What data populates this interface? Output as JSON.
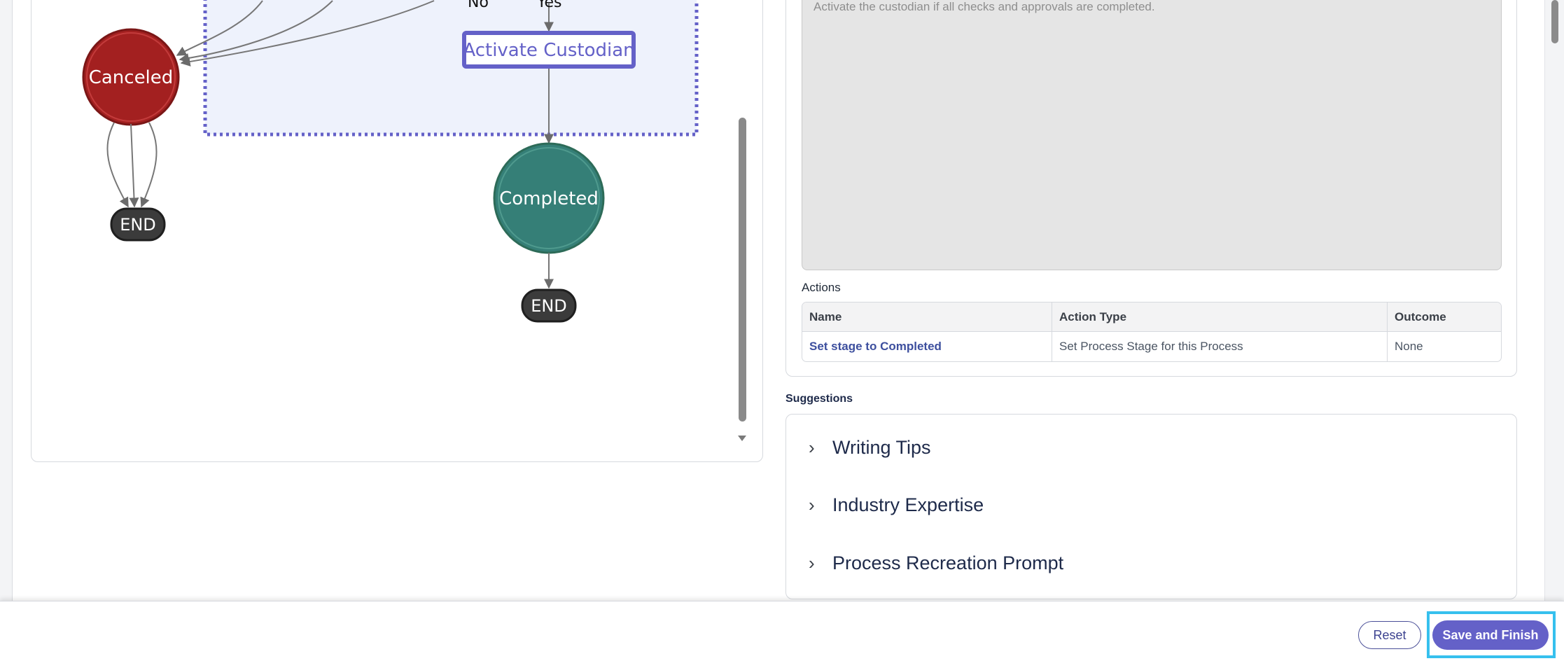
{
  "diagram": {
    "labels": {
      "no": "No",
      "yes": "Yes",
      "canceled": "Canceled",
      "activate": "Activate Custodian",
      "completed": "Completed",
      "end": "END"
    },
    "colors": {
      "canceled": "#a32020",
      "completed": "#357f77",
      "activate": "#6461c8",
      "end": "#3b3b3b",
      "group_fill": "#eef2fc",
      "group_border": "#6461c8"
    }
  },
  "details": {
    "description": "Activate the custodian if all checks and approvals are completed.",
    "actions_label": "Actions",
    "table": {
      "headers": [
        "Name",
        "Action Type",
        "Outcome"
      ],
      "rows": [
        [
          "Set stage to Completed",
          "Set Process Stage for this Process",
          "None"
        ]
      ]
    }
  },
  "suggestions": {
    "label": "Suggestions",
    "items": [
      "Writing Tips",
      "Industry Expertise",
      "Process Recreation Prompt"
    ]
  },
  "footer": {
    "reset": "Reset",
    "save": "Save and Finish"
  }
}
